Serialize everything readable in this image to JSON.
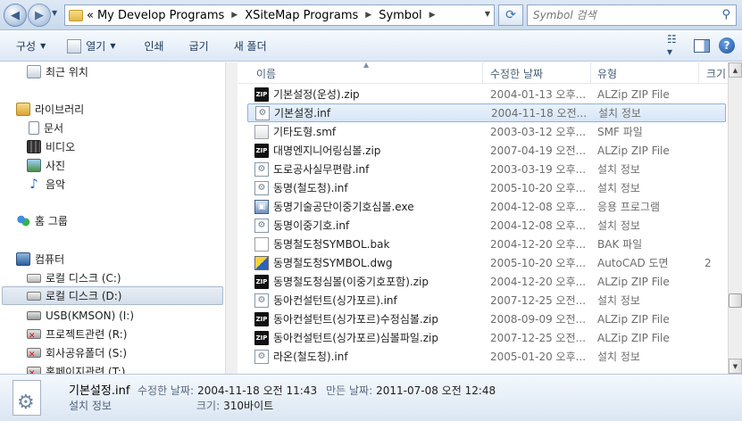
{
  "address": {
    "overflow": "«",
    "crumbs": [
      "My Develop Programs",
      "XSiteMap Programs",
      "Symbol"
    ]
  },
  "search": {
    "placeholder": "Symbol 검색"
  },
  "toolbar": {
    "organize": "구성",
    "open": "열기",
    "print": "인쇄",
    "burn": "굽기",
    "new_folder": "새 폴더"
  },
  "nav": {
    "recent": "최근 위치",
    "libraries": "라이브러리",
    "documents": "문서",
    "videos": "비디오",
    "pictures": "사진",
    "music": "음악",
    "homegroup": "홈 그룹",
    "computer": "컴퓨터",
    "drive_c": "로컬 디스크 (C:)",
    "drive_d": "로컬 디스크 (D:)",
    "usb": "USB(KMSON) (I:)",
    "project": "프로젝트관련 (R:)",
    "shared": "회사공유폴더 (S:)",
    "homepage": "홈페이지관련 (T:)"
  },
  "columns": {
    "name": "이름",
    "date": "수정한 날짜",
    "type": "유형",
    "size": "크기"
  },
  "files": [
    {
      "name": "기본설정(운성).zip",
      "date": "2004-01-13 오후...",
      "type": "ALZip ZIP File",
      "size": "",
      "icon": "zip-icon"
    },
    {
      "name": "기본설정.inf",
      "date": "2004-11-18 오전...",
      "type": "설치 정보",
      "size": "",
      "icon": "inf-icon",
      "selected": true
    },
    {
      "name": "기타도형.smf",
      "date": "2003-03-12 오후...",
      "type": "SMF 파일",
      "size": "",
      "icon": "smf-icon"
    },
    {
      "name": "대명엔지니어링심볼.zip",
      "date": "2007-04-19 오전...",
      "type": "ALZip ZIP File",
      "size": "",
      "icon": "zip-icon"
    },
    {
      "name": "도로공사실무편람.inf",
      "date": "2003-03-19 오후...",
      "type": "설치 정보",
      "size": "",
      "icon": "inf-icon"
    },
    {
      "name": "동명(철도청).inf",
      "date": "2005-10-20 오후...",
      "type": "설치 정보",
      "size": "",
      "icon": "inf-icon"
    },
    {
      "name": "동명기술공단이중기호심볼.exe",
      "date": "2004-12-08 오후...",
      "type": "응용 프로그램",
      "size": "",
      "icon": "exe-icon"
    },
    {
      "name": "동명이중기호.inf",
      "date": "2004-12-08 오후...",
      "type": "설치 정보",
      "size": "",
      "icon": "inf-icon"
    },
    {
      "name": "동명철도청SYMBOL.bak",
      "date": "2004-12-20 오후...",
      "type": "BAK 파일",
      "size": "",
      "icon": "bak-icon"
    },
    {
      "name": "동명철도청SYMBOL.dwg",
      "date": "2005-10-20 오후...",
      "type": "AutoCAD 도면",
      "size": "2",
      "icon": "dwg-icon"
    },
    {
      "name": "동명철도청심볼(이중기호포함).zip",
      "date": "2004-12-20 오후...",
      "type": "ALZip ZIP File",
      "size": "",
      "icon": "zip-icon"
    },
    {
      "name": "동아컨설턴트(싱가포르).inf",
      "date": "2007-12-25 오전...",
      "type": "설치 정보",
      "size": "",
      "icon": "inf-icon"
    },
    {
      "name": "동아컨설턴트(싱가포르)수정심볼.zip",
      "date": "2008-09-09 오전...",
      "type": "ALZip ZIP File",
      "size": "",
      "icon": "zip-icon"
    },
    {
      "name": "동아컨설턴트(싱가포르)심볼파일.zip",
      "date": "2007-12-25 오전...",
      "type": "ALZip ZIP File",
      "size": "",
      "icon": "zip-icon"
    },
    {
      "name": "라온(철도청).inf",
      "date": "2005-01-20 오후...",
      "type": "설치 정보",
      "size": "",
      "icon": "inf-icon"
    }
  ],
  "details": {
    "name": "기본설정.inf",
    "type": "설치 정보",
    "modified_label": "수정한 날짜:",
    "modified_value": "2004-11-18 오전 11:43",
    "created_label": "만든 날짜:",
    "created_value": "2011-07-08 오전 12:48",
    "size_label": "크기:",
    "size_value": "310바이트"
  }
}
